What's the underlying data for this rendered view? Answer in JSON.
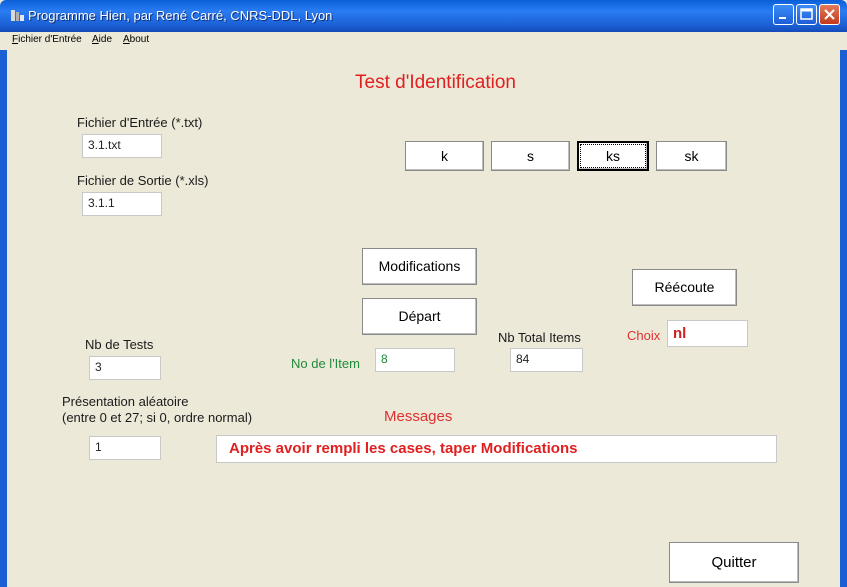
{
  "window": {
    "title": "Programme Hien, par René Carré, CNRS-DDL, Lyon",
    "colors": {
      "titlebar": "#1b5fd4",
      "accent_red": "#e02020",
      "green": "#1f8a3a"
    }
  },
  "menu": {
    "items": [
      {
        "pre": "",
        "u": "F",
        "post": "ichier d'Entrée"
      },
      {
        "pre": "",
        "u": "A",
        "post": "ide"
      },
      {
        "pre": "",
        "u": "A",
        "post": "bout"
      }
    ]
  },
  "main": {
    "title": "Test d'Identification",
    "input_file": {
      "label": "Fichier d'Entrée (*.txt)",
      "value": "3.1.txt"
    },
    "output_file": {
      "label": "Fichier de Sortie (*.xls)",
      "value": "3.1.1"
    },
    "choices": [
      "k",
      "s",
      "ks",
      "sk"
    ],
    "modifications_label": "Modifications",
    "depart_label": "Départ",
    "reecoute_label": "Réécoute",
    "nb_tests": {
      "label": "Nb de Tests",
      "value": "3"
    },
    "item_no": {
      "label": "No de l'Item",
      "value": "8"
    },
    "nb_total": {
      "label": "Nb Total Items",
      "value": "84"
    },
    "choix": {
      "label": "Choix",
      "value": "nl"
    },
    "random": {
      "label1": "Présentation aléatoire",
      "label2": "(entre 0 et 27; si 0, ordre normal)",
      "value": "1"
    },
    "messages": {
      "label": "Messages",
      "text": "Après avoir rempli les cases, taper Modifications"
    },
    "quit_label": "Quitter"
  }
}
